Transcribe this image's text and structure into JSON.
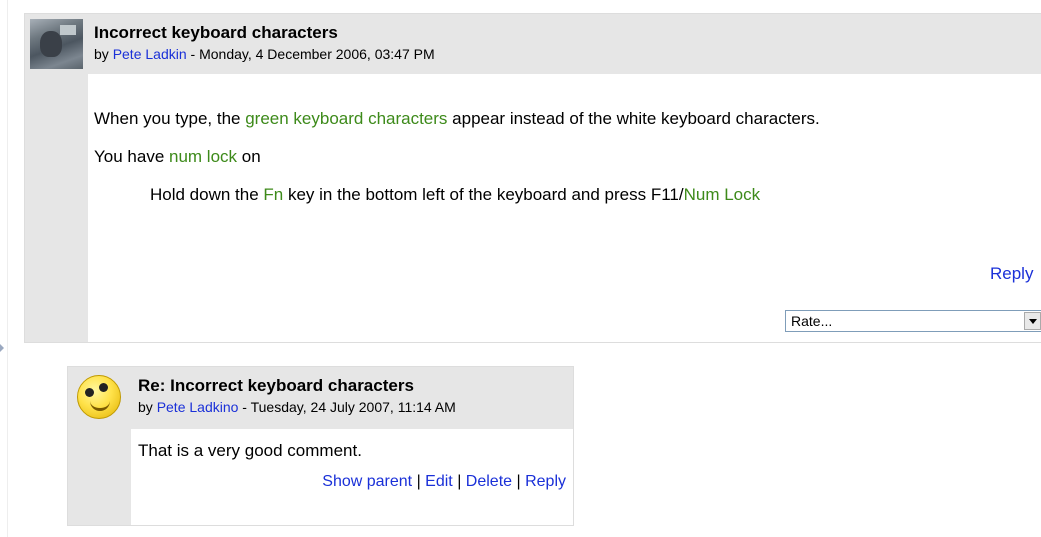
{
  "post": {
    "title": "Incorrect keyboard characters",
    "by_prefix": "by",
    "author": "Pete Ladkin",
    "date": " - Monday, 4 December 2006, 03:47 PM",
    "line1": {
      "pre": "When you type, the ",
      "term": "green keyboard characters",
      "post": " appear instead of the white keyboard characters."
    },
    "line2": {
      "pre": "You have ",
      "term": "num lock",
      "post": " on"
    },
    "line3": {
      "pre": "Hold down the ",
      "term1": "Fn",
      "mid": " key in the bottom left of the keyboard and press F11/",
      "term2": "Num Lock"
    },
    "reply_label": "Reply",
    "rate": {
      "selected": "Rate..."
    }
  },
  "reply": {
    "title": "Re: Incorrect keyboard characters",
    "by_prefix": "by",
    "author": "Pete Ladkino",
    "date": " - Tuesday, 24 July 2007, 11:14 AM",
    "message": "That is a very good comment.",
    "commands": {
      "show_parent": "Show parent",
      "edit": "Edit",
      "delete": "Delete",
      "reply": "Reply",
      "separator": " | "
    }
  },
  "colors": {
    "link": "#1a30d8",
    "glossary_term": "#3d8a1a",
    "header_bg": "#e6e6e6",
    "border": "#dddddd"
  }
}
